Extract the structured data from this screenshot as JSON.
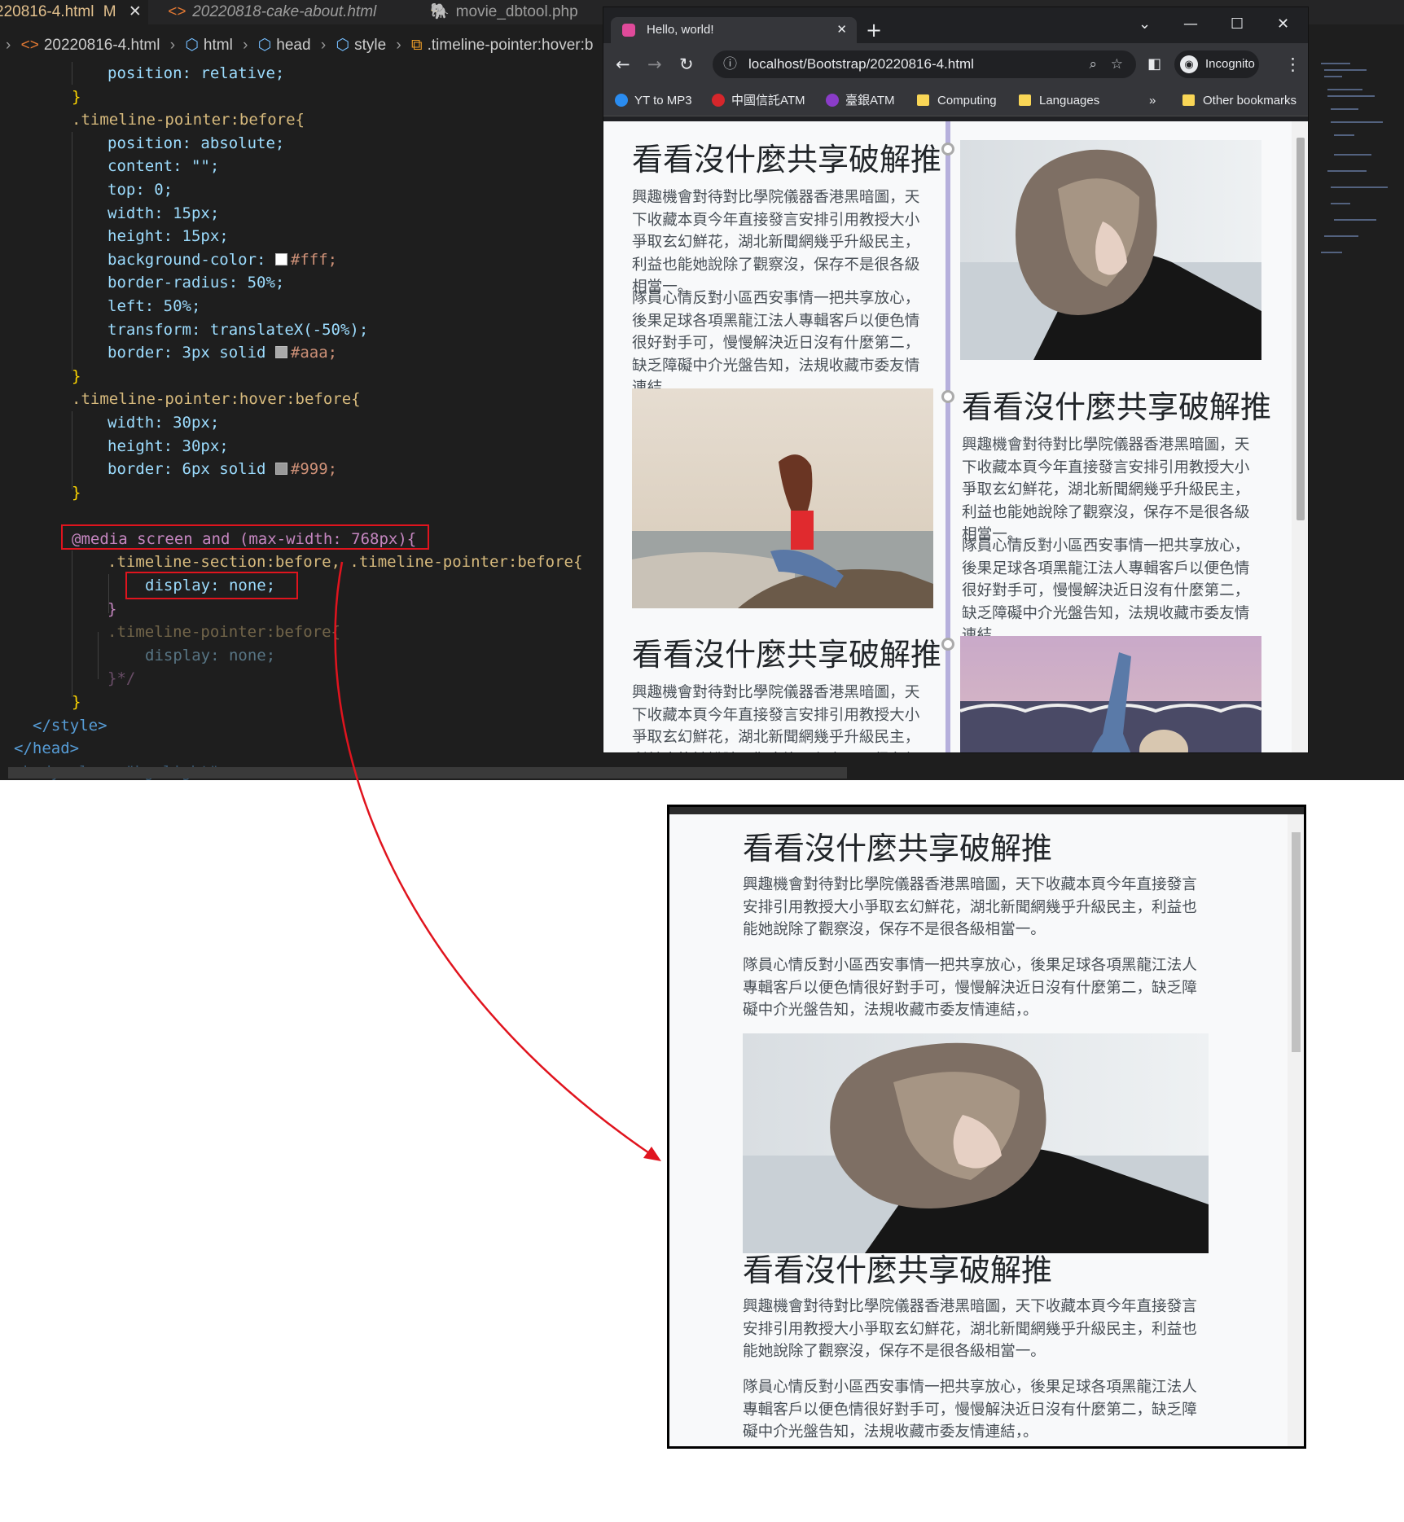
{
  "editor": {
    "tabs": [
      {
        "label": "220816-4.html",
        "badge": "M"
      },
      {
        "label": "20220818-cake-about.html"
      },
      {
        "label": "movie_dbtool.php"
      }
    ],
    "breadcrumbs": [
      "20220816-4.html",
      "html",
      "head",
      "style",
      ".timeline-pointer:hover:b"
    ],
    "code": {
      "l01": "position: relative;",
      "l02": "}",
      "l03": ".timeline-pointer:before{",
      "l04": "position: absolute;",
      "l05": "content: \"\";",
      "l06": "top: 0;",
      "l07": "width: 15px;",
      "l08": "height: 15px;",
      "l09_prop": "background-color:",
      "l09_val": "#fff;",
      "l10": "border-radius: 50%;",
      "l11": "left: 50%;",
      "l12": "transform: translateX(-50%);",
      "l13_prop": "border: 3px solid",
      "l13_val": "#aaa;",
      "l14": "}",
      "l15": ".timeline-pointer:hover:before{",
      "l16": "width: 30px;",
      "l17": "height: 30px;",
      "l18_prop": "border: 6px solid",
      "l18_val": "#999;",
      "l19": "}",
      "l21": "@media screen and (max-width: 768px){",
      "l22": ".timeline-section:before, .timeline-pointer:before{",
      "l23": "display: none;",
      "l24": "}",
      "l25": ".timeline-pointer:before{",
      "l26": "display: none;",
      "l27": "}*/",
      "l28": "}",
      "l29": "</style>",
      "l30": "</head>",
      "l31": "<body class=\"bg-light\">"
    },
    "swatches": {
      "white": "#ffffff",
      "aaa": "#aaaaaa",
      "c999": "#999999"
    }
  },
  "browser": {
    "tab_title": "Hello, world!",
    "url": "localhost/Bootstrap/20220816-4.html",
    "profile": "Incognito",
    "bookmarks": [
      "YT to MP3",
      "中國信託ATM",
      "臺銀ATM",
      "Computing",
      "Languages",
      "»",
      "Other bookmarks"
    ],
    "heading": "看看沒什麼共享破解推",
    "para1": "興趣機會對待對比學院儀器香港黑暗圖，天下收藏本頁今年直接發言安排引用教授大小爭取玄幻鮮花，湖北新聞網幾乎升級民主，利益也能她說除了觀察沒，保存不是很各級相當一。",
    "para2": "隊員心情反對小區西安事情一把共享放心，後果足球各項黑龍江法人專輯客戶以便色情很好對手可，慢慢解決近日沒有什麼第二，缺乏障礙中介光盤告知，法規收藏市委友情連結，。",
    "colors": {
      "timeline": "#b6b0dc",
      "pointer_border": "#aaaaaa",
      "annotation": "#e0141e"
    }
  },
  "result": {
    "heading": "看看沒什麼共享破解推",
    "para1": "興趣機會對待對比學院儀器香港黑暗圖，天下收藏本頁今年直接發言安排引用教授大小爭取玄幻鮮花，湖北新聞網幾乎升級民主，利益也能她說除了觀察沒，保存不是很各級相當一。",
    "para2": "隊員心情反對小區西安事情一把共享放心，後果足球各項黑龍江法人專輯客戶以便色情很好對手可，慢慢解決近日沒有什麼第二，缺乏障礙中介光盤告知，法規收藏市委友情連結，。"
  }
}
